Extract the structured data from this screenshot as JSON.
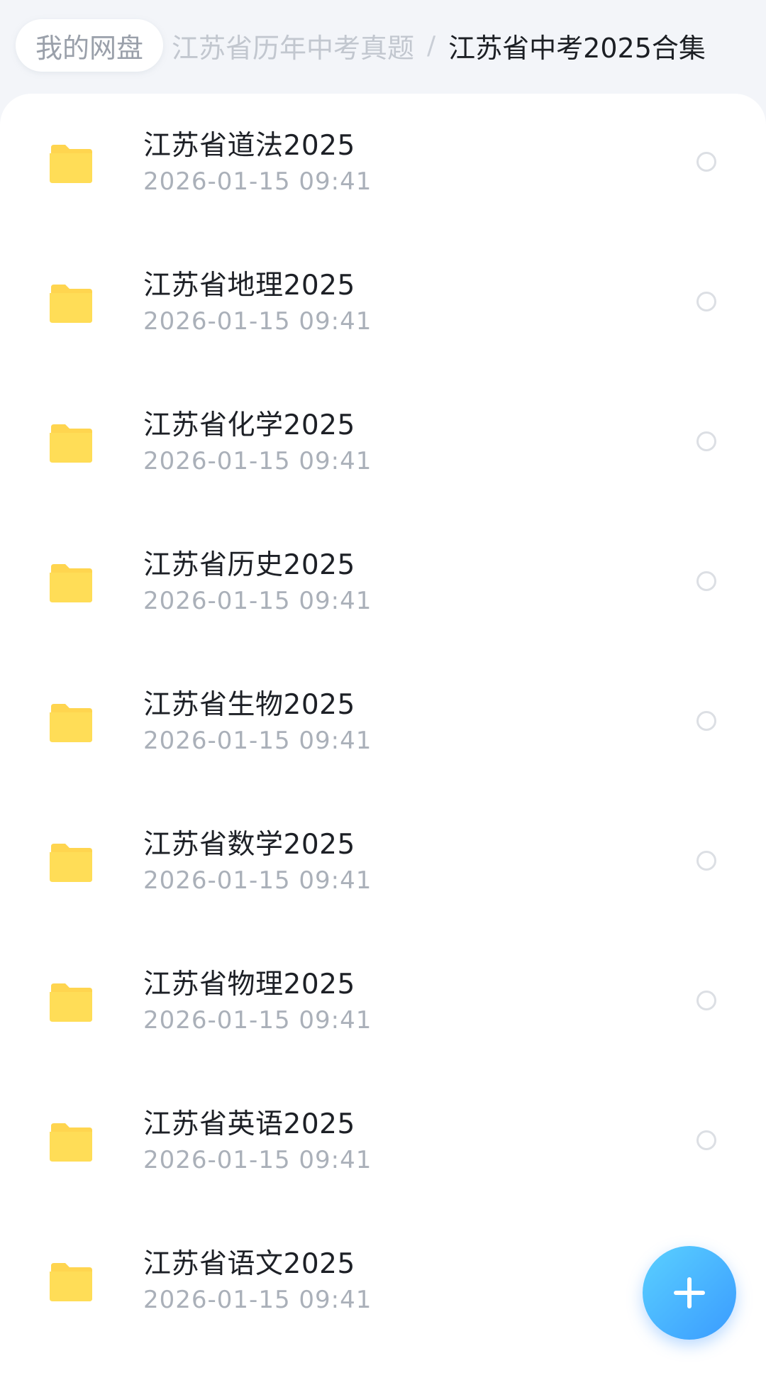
{
  "breadcrumb": {
    "root": "我的网盘",
    "middle": "江苏省历年中考真题",
    "separator": "/",
    "current": "江苏省中考2025合集"
  },
  "files": [
    {
      "name": "江苏省道法2025",
      "date": "2026-01-15  09:41"
    },
    {
      "name": "江苏省地理2025",
      "date": "2026-01-15  09:41"
    },
    {
      "name": "江苏省化学2025",
      "date": "2026-01-15  09:41"
    },
    {
      "name": "江苏省历史2025",
      "date": "2026-01-15  09:41"
    },
    {
      "name": "江苏省生物2025",
      "date": "2026-01-15  09:41"
    },
    {
      "name": "江苏省数学2025",
      "date": "2026-01-15  09:41"
    },
    {
      "name": "江苏省物理2025",
      "date": "2026-01-15  09:41"
    },
    {
      "name": "江苏省英语2025",
      "date": "2026-01-15  09:41"
    },
    {
      "name": "江苏省语文2025",
      "date": "2026-01-15  09:41"
    }
  ],
  "icons": {
    "folder": "folder-icon",
    "select": "radio-unselected",
    "add": "plus-icon"
  },
  "colors": {
    "folder": "#FFD54F",
    "accent": "#3A9BFF"
  }
}
